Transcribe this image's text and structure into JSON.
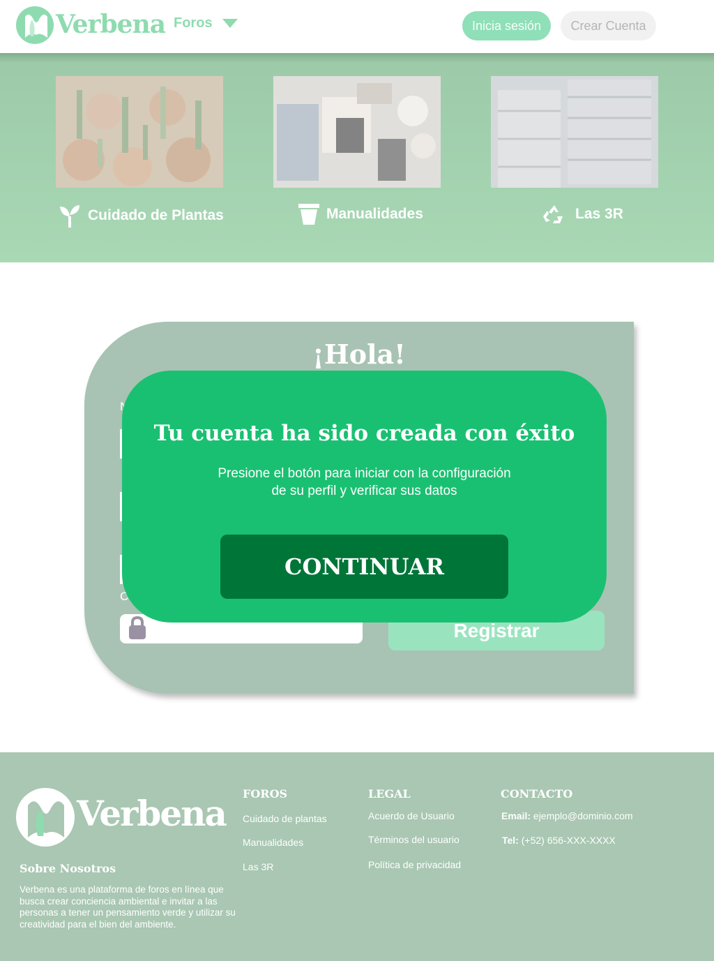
{
  "header": {
    "logo_text": "Verbena",
    "foros_label": "Foros",
    "login_label": "Inicia sesión",
    "create_label": "Crear Cuenta"
  },
  "categories": [
    {
      "label": "Cuidado de Plantas",
      "icon": "sprout-icon"
    },
    {
      "label": "Manualidades",
      "icon": "pot-icon"
    },
    {
      "label": "Las 3R",
      "icon": "recycle-icon"
    }
  ],
  "form": {
    "greeting": "¡Hola!",
    "register_label": "Registrar"
  },
  "modal": {
    "title": "Tu cuenta ha sido creada con éxito",
    "line1": "Presione el botón para iniciar con la configuración",
    "line2": "de su perfil y verificar sus datos",
    "continue_label": "CONTINUAR"
  },
  "footer": {
    "logo_text": "Verbena",
    "about_heading": "Sobre Nosotros",
    "about_text": "Verbena es una plataforma de foros en línea que busca crear conciencia ambiental e invitar a las personas a tener un pensamiento verde y utilizar su creatividad para el bien del ambiente.",
    "foros": {
      "heading": "FOROS",
      "links": [
        "Cuidado de plantas",
        "Manualidades",
        "Las 3R"
      ]
    },
    "legal": {
      "heading": "LEGAL",
      "links": [
        "Acuerdo de Usuario",
        "Términos del usuario",
        "Política de privacidad"
      ]
    },
    "contacto": {
      "heading": "CONTACTO",
      "email_label": "Email:",
      "email_value": "ejemplo@dominio.com",
      "tel_label": "Tel:",
      "tel_value": "(+52) 656-XXX-XXXX"
    }
  },
  "colors": {
    "brand_green": "#8fdbb0",
    "modal_green": "#1ac072",
    "button_dark_green": "#007538",
    "footer_bg": "#a9c7b2"
  }
}
